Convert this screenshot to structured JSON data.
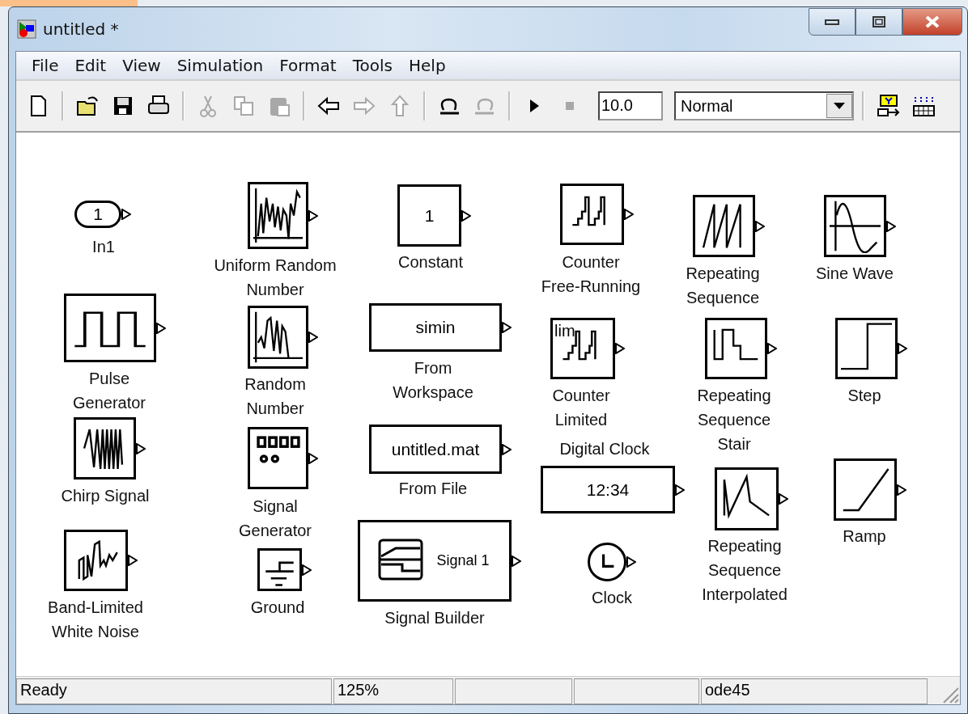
{
  "window": {
    "title": "untitled *",
    "controls": [
      {
        "kind": "minimize"
      },
      {
        "kind": "maximize"
      },
      {
        "kind": "close"
      }
    ]
  },
  "menu": [
    "File",
    "Edit",
    "View",
    "Simulation",
    "Format",
    "Tools",
    "Help"
  ],
  "toolbar": [
    {
      "kind": "new"
    },
    {
      "kind": "separator"
    },
    {
      "kind": "open"
    },
    {
      "kind": "save"
    },
    {
      "kind": "print"
    },
    {
      "kind": "separator"
    },
    {
      "kind": "cut",
      "disabled": true
    },
    {
      "kind": "copy",
      "disabled": true
    },
    {
      "kind": "paste",
      "disabled": true
    },
    {
      "kind": "separator"
    },
    {
      "kind": "back",
      "disabled": false
    },
    {
      "kind": "forward",
      "disabled": true
    },
    {
      "kind": "up",
      "disabled": true
    },
    {
      "kind": "separator"
    },
    {
      "kind": "undo",
      "disabled": false
    },
    {
      "kind": "redo",
      "disabled": true
    },
    {
      "kind": "separator"
    },
    {
      "kind": "play",
      "disabled": false
    },
    {
      "kind": "stop",
      "disabled": true
    },
    {
      "kind": "stop-time",
      "value": "10.0"
    },
    {
      "kind": "mode",
      "value": "Normal"
    },
    {
      "kind": "separator"
    },
    {
      "kind": "model-explorer"
    },
    {
      "kind": "library"
    }
  ],
  "blocks": [
    {
      "kind": "inport",
      "text": "1",
      "label": [
        "In1"
      ]
    },
    {
      "kind": "uniform-random",
      "label": [
        "Uniform Random",
        "Number"
      ]
    },
    {
      "kind": "constant",
      "text": "1",
      "label": [
        "Constant"
      ]
    },
    {
      "kind": "counter",
      "label": [
        "Counter",
        "Free-Running"
      ]
    },
    {
      "kind": "sawtooth",
      "label": [
        "Repeating",
        "Sequence"
      ]
    },
    {
      "kind": "sine",
      "label": [
        "Sine Wave"
      ]
    },
    {
      "kind": "pulse",
      "label": [
        "Pulse",
        "Generator"
      ]
    },
    {
      "kind": "random",
      "label": [
        "Random",
        "Number"
      ]
    },
    {
      "kind": "constant",
      "text": "simin",
      "label": [
        "From",
        "Workspace"
      ]
    },
    {
      "kind": "counter",
      "text": "lim",
      "label": [
        "Counter",
        "Limited"
      ]
    },
    {
      "kind": "stair",
      "label": [
        "Repeating",
        "Sequence",
        "Stair"
      ]
    },
    {
      "kind": "step",
      "label": [
        "Step"
      ]
    },
    {
      "kind": "chirp",
      "label": [
        "Chirp Signal"
      ]
    },
    {
      "kind": "signal-generator",
      "label": [
        "Signal",
        "Generator"
      ]
    },
    {
      "kind": "constant",
      "text": "untitled.mat",
      "label": [
        "From File"
      ]
    },
    {
      "kind": "constant",
      "text": "12:34",
      "label": [
        "Digital Clock"
      ]
    },
    {
      "kind": "interpolated",
      "label": [
        "Repeating",
        "Sequence",
        "Interpolated"
      ]
    },
    {
      "kind": "ramp",
      "label": [
        "Ramp"
      ]
    },
    {
      "kind": "noise",
      "label": [
        "Band-Limited",
        "White Noise"
      ]
    },
    {
      "kind": "ground",
      "label": [
        "Ground"
      ]
    },
    {
      "kind": "signal-builder",
      "text": "Signal 1",
      "label": [
        "Signal Builder"
      ]
    },
    {
      "kind": "clock",
      "label": [
        "Clock"
      ]
    }
  ],
  "status_bar": [
    {
      "kind": "text",
      "text": "Ready"
    },
    {
      "kind": "text",
      "text": "125%"
    },
    {
      "kind": "blank"
    },
    {
      "kind": "blank"
    },
    {
      "kind": "text",
      "text": "ode45"
    }
  ]
}
